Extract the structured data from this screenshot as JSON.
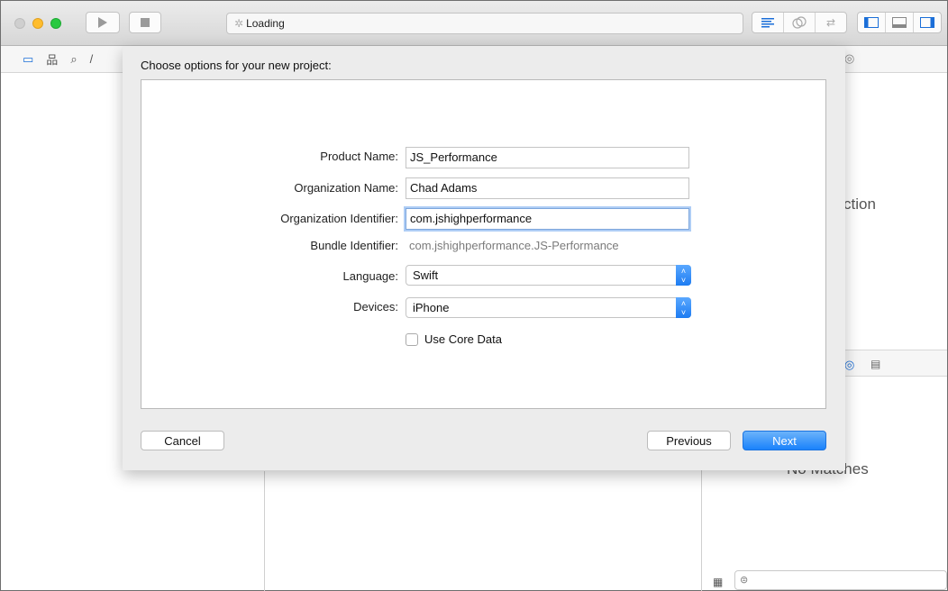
{
  "toolbar": {
    "activity_text": "Loading"
  },
  "background": {
    "utility_partial_text": "ction",
    "no_matches_partial": "No Matches"
  },
  "sheet": {
    "title": "Choose options for your new project:",
    "fields": {
      "product_name": {
        "label": "Product Name:",
        "value": "JS_Performance"
      },
      "organization_name": {
        "label": "Organization Name:",
        "value": "Chad Adams"
      },
      "organization_identifier": {
        "label": "Organization Identifier:",
        "value": "com.jshighperformance"
      },
      "bundle_identifier": {
        "label": "Bundle Identifier:",
        "value": "com.jshighperformance.JS-Performance"
      },
      "language": {
        "label": "Language:",
        "value": "Swift"
      },
      "devices": {
        "label": "Devices:",
        "value": "iPhone"
      },
      "use_core_data": {
        "label": "Use Core Data",
        "checked": false
      }
    },
    "buttons": {
      "cancel": "Cancel",
      "previous": "Previous",
      "next": "Next"
    }
  },
  "colors": {
    "accent": "#1a82fb",
    "focus_ring": "#aecdf5"
  }
}
